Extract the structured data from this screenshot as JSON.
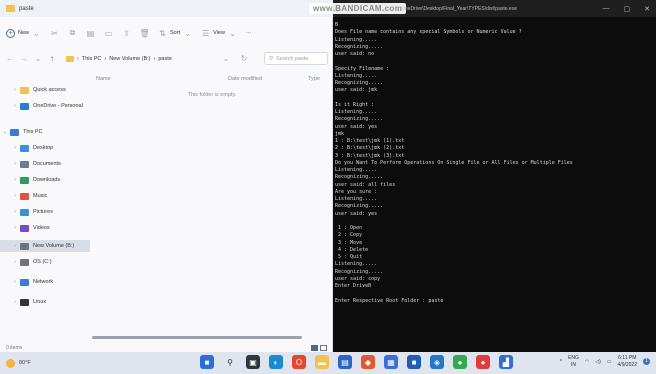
{
  "explorer": {
    "title": "paste",
    "toolbar": {
      "new_label": "New",
      "sort_label": "Sort",
      "view_label": "View",
      "more_label": "···"
    },
    "address": {
      "crumbs": [
        "This PC",
        "New Volume (B:)",
        "paste"
      ],
      "search_placeholder": "Search paste"
    },
    "sidebar": [
      {
        "label": "Quick access",
        "icon": "star-icon",
        "color": "#f2c14e"
      },
      {
        "label": "OneDrive - Personal",
        "icon": "cloud-icon",
        "color": "#2b7cd3"
      },
      {
        "label": "This PC",
        "icon": "pc-icon",
        "color": "#3b7bd8"
      },
      {
        "label": "Desktop",
        "icon": "desktop-folder-icon",
        "color": "#3b8fe0"
      },
      {
        "label": "Documents",
        "icon": "documents-folder-icon",
        "color": "#6b7d93"
      },
      {
        "label": "Downloads",
        "icon": "downloads-folder-icon",
        "color": "#2e9e57"
      },
      {
        "label": "Music",
        "icon": "music-folder-icon",
        "color": "#e0533d"
      },
      {
        "label": "Pictures",
        "icon": "pictures-folder-icon",
        "color": "#3f8fd7"
      },
      {
        "label": "Videos",
        "icon": "videos-folder-icon",
        "color": "#7a4bc4"
      },
      {
        "label": "New Volume (B:)",
        "icon": "drive-icon",
        "color": "#6c7480"
      },
      {
        "label": "OS (C:)",
        "icon": "drive-icon",
        "color": "#6c7480"
      },
      {
        "label": "Network",
        "icon": "network-icon",
        "color": "#3b7bd8"
      },
      {
        "label": "Linux",
        "icon": "linux-icon",
        "color": "#333333"
      }
    ],
    "columns": [
      "Name",
      "Date modified",
      "Type"
    ],
    "empty_message": "This folder is empty.",
    "status": "0 items"
  },
  "console": {
    "title_path": "OneDrive\\Desktop\\Final_Year\\TYPES\\dist\\paste.exe",
    "watermark": "www.BANDICAM.com",
    "lines": [
      "B",
      "Does File name contains any special Symbols or Numeric Value ?",
      "Listening.....",
      "Recognizing.....",
      "user said: no",
      "",
      "Specify Filename :",
      "Listening.....",
      "Recognizing.....",
      "user said: jmk",
      "",
      "Is it Right :",
      "Listening.....",
      "Recognizing.....",
      "user said: yes",
      "jmk",
      "1 : B:\\test\\jmk (1).txt",
      "2 : B:\\test\\jmk (2).txt",
      "3 : B:\\test\\jmk (3).txt",
      "Do you Want To Perform Operations On Single File or All Files or Multiple Files",
      "Listening.....",
      "Recognizing.....",
      "user said: all files",
      "Are you sure :",
      "Listening.....",
      "Recognizing.....",
      "user said: yes",
      "",
      " 1 : Open",
      " 2 : Copy",
      " 3 : Move",
      " 4 : Delete",
      " 5 : Quit",
      "Listening.....",
      "Recognizing.....",
      "user said: copy",
      "Enter DriveB",
      "",
      "Enter Respective Root Folder : paste"
    ]
  },
  "taskbar": {
    "weather": "80°F",
    "apps": [
      {
        "name": "start-icon",
        "color": "#2a6fd6",
        "glyph": "■"
      },
      {
        "name": "search-icon",
        "color": "#dfe4ee",
        "glyph": "⚲"
      },
      {
        "name": "task-view-icon",
        "color": "#30363d",
        "glyph": "▣"
      },
      {
        "name": "edge-icon",
        "color": "#1b8ad3",
        "glyph": "◐"
      },
      {
        "name": "office-icon",
        "color": "#e6462e",
        "glyph": "O"
      },
      {
        "name": "file-explorer-icon",
        "color": "#f2c14e",
        "glyph": "▬"
      },
      {
        "name": "store-icon",
        "color": "#2b66c3",
        "glyph": "▤"
      },
      {
        "name": "app-orange-icon",
        "color": "#e4572e",
        "glyph": "◆"
      },
      {
        "name": "photos-icon",
        "color": "#3b6fd8",
        "glyph": "▦"
      },
      {
        "name": "mail-icon",
        "color": "#1e5fb5",
        "glyph": "■"
      },
      {
        "name": "vscode-icon",
        "color": "#2277c9",
        "glyph": "◈"
      },
      {
        "name": "chrome-icon",
        "color": "#34a853",
        "glyph": "●"
      },
      {
        "name": "red-app-icon",
        "color": "#e23b3b",
        "glyph": "●"
      },
      {
        "name": "paint-icon",
        "color": "#2f6fcf",
        "glyph": "▟"
      }
    ],
    "lang_top": "ENG",
    "lang_bottom": "IN",
    "time": "6:11 PM",
    "date": "4/9/2022"
  }
}
